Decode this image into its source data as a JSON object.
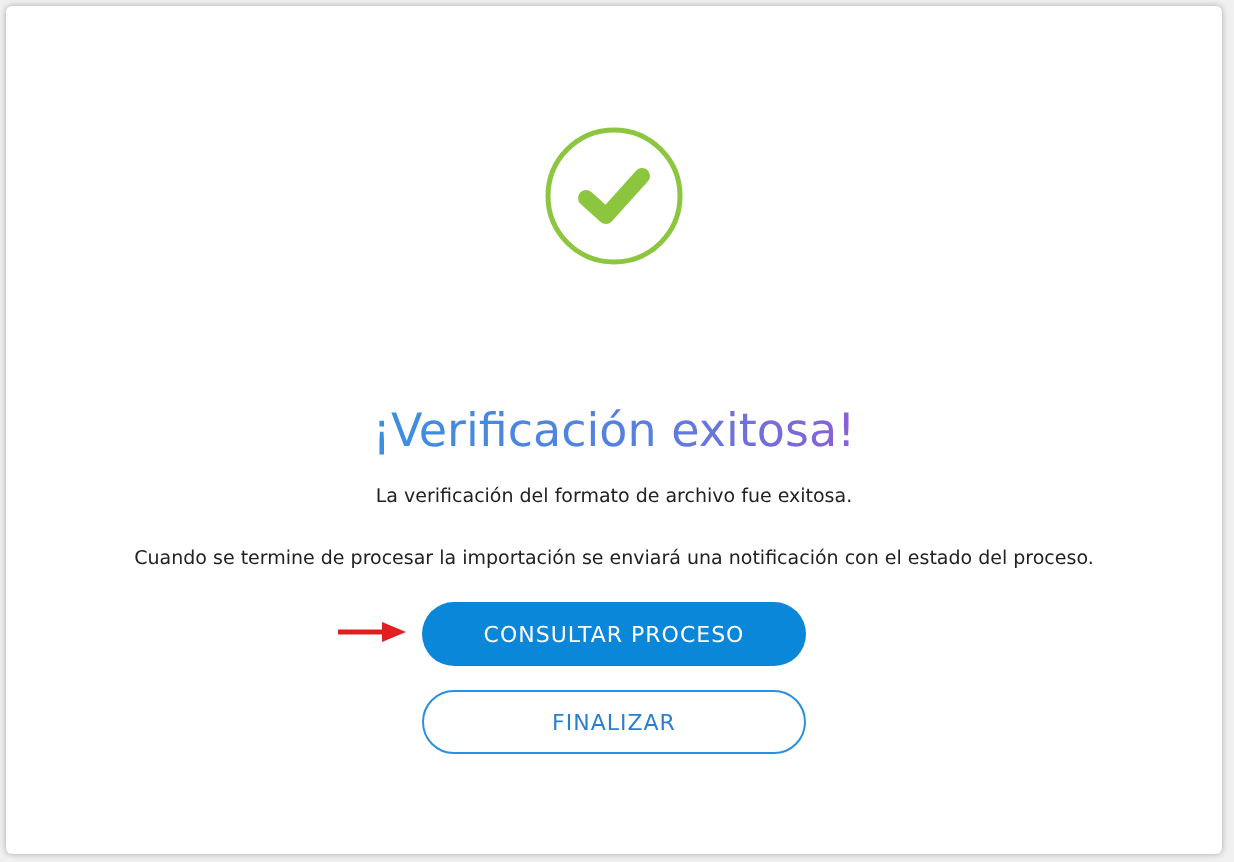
{
  "title": "¡Verificación exitosa!",
  "messages": [
    "La verificación del formato de archivo fue exitosa.",
    "Cuando se termine de procesar la importación se enviará una notificación con el estado del proceso."
  ],
  "buttons": [
    {
      "label": "CONSULTAR PROCESO",
      "kind": "primary"
    },
    {
      "label": "FINALIZAR",
      "kind": "outline"
    }
  ]
}
